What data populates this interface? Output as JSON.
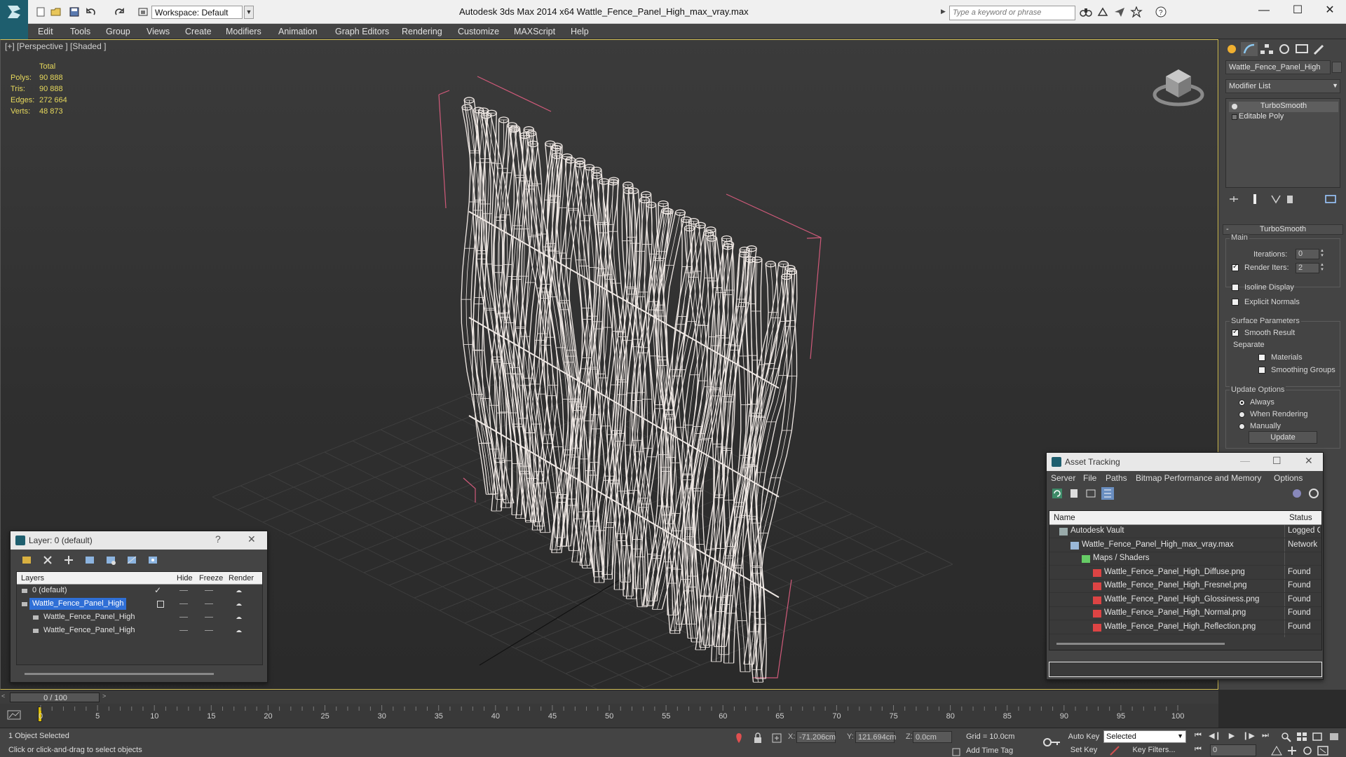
{
  "titlebar": {
    "workspace": "Workspace: Default",
    "app_title": "Autodesk 3ds Max  2014 x64     Wattle_Fence_Panel_High_max_vray.max",
    "search_placeholder": "Type a keyword or phrase",
    "min": "—",
    "max": "☐",
    "close": "✕"
  },
  "menu": [
    "Edit",
    "Tools",
    "Group",
    "Views",
    "Create",
    "Modifiers",
    "Animation",
    "Graph Editors",
    "Rendering",
    "Customize",
    "MAXScript",
    "Help"
  ],
  "viewport": {
    "label": "[+] [Perspective ] [Shaded ]",
    "stats": {
      "header": "Total",
      "rows": [
        {
          "label": "Polys:",
          "value": "90 888"
        },
        {
          "label": "Tris:",
          "value": "90 888"
        },
        {
          "label": "Edges:",
          "value": "272 664"
        },
        {
          "label": "Verts:",
          "value": "48 873"
        }
      ]
    }
  },
  "command_panel": {
    "object_name": "Wattle_Fence_Panel_High",
    "modifier_list": "Modifier List",
    "stack": [
      "TurboSmooth",
      "Editable Poly"
    ],
    "rollout_title": "TurboSmooth",
    "main_label": "Main",
    "iterations_label": "Iterations:",
    "iterations_value": "0",
    "render_iters_label": "Render Iters:",
    "render_iters_value": "2",
    "render_iters_checked": true,
    "isoline_label": "Isoline Display",
    "isoline_checked": false,
    "explicit_normals_label": "Explicit Normals",
    "explicit_normals_checked": false,
    "surface_params_label": "Surface Parameters",
    "smooth_result_label": "Smooth Result",
    "smooth_result_checked": true,
    "separate_label": "Separate",
    "materials_label": "Materials",
    "materials_checked": false,
    "smoothing_groups_label": "Smoothing Groups",
    "smoothing_groups_checked": false,
    "update_options_label": "Update Options",
    "update_options": [
      "Always",
      "When Rendering",
      "Manually"
    ],
    "update_selected": 0,
    "update_button": "Update"
  },
  "layer_window": {
    "title": "Layer: 0 (default)",
    "help": "?",
    "close": "✕",
    "columns": [
      "Layers",
      "Hide",
      "Freeze",
      "Render"
    ],
    "rows": [
      {
        "name": "0 (default)",
        "selected": false,
        "indent": 1
      },
      {
        "name": "Wattle_Fence_Panel_High",
        "selected": true,
        "indent": 1
      },
      {
        "name": "Wattle_Fence_Panel_High",
        "selected": false,
        "indent": 2
      },
      {
        "name": "Wattle_Fence_Panel_High",
        "selected": false,
        "indent": 2
      }
    ]
  },
  "asset_window": {
    "title": "Asset Tracking",
    "menu": [
      "Server",
      "File",
      "Paths",
      "Bitmap Performance and Memory",
      "Options"
    ],
    "columns": [
      "Name",
      "Status"
    ],
    "rows": [
      {
        "name": "Autodesk Vault",
        "status": "Logged O",
        "indent": 1,
        "icon": "vault-icon"
      },
      {
        "name": "Wattle_Fence_Panel_High_max_vray.max",
        "status": "Network",
        "indent": 2,
        "icon": "max-file-icon"
      },
      {
        "name": "Maps / Shaders",
        "status": "",
        "indent": 3,
        "icon": "maps-icon"
      },
      {
        "name": "Wattle_Fence_Panel_High_Diffuse.png",
        "status": "Found",
        "indent": 4,
        "icon": "png-icon"
      },
      {
        "name": "Wattle_Fence_Panel_High_Fresnel.png",
        "status": "Found",
        "indent": 4,
        "icon": "png-icon"
      },
      {
        "name": "Wattle_Fence_Panel_High_Glossiness.png",
        "status": "Found",
        "indent": 4,
        "icon": "png-icon"
      },
      {
        "name": "Wattle_Fence_Panel_High_Normal.png",
        "status": "Found",
        "indent": 4,
        "icon": "png-icon"
      },
      {
        "name": "Wattle_Fence_Panel_High_Reflection.png",
        "status": "Found",
        "indent": 4,
        "icon": "png-icon"
      }
    ]
  },
  "timeline": {
    "slider_label": "0 / 100",
    "ticks": [
      "0",
      "5",
      "10",
      "15",
      "20",
      "25",
      "30",
      "35",
      "40",
      "45",
      "50",
      "55",
      "60",
      "65",
      "70",
      "75",
      "80",
      "85",
      "90",
      "95",
      "100"
    ]
  },
  "status": {
    "selection": "1 Object Selected",
    "prompt": "Click or click-and-drag to select objects",
    "x_label": "X:",
    "x_value": "-71.206cm",
    "y_label": "Y:",
    "y_value": "121.694cm",
    "z_label": "Z:",
    "z_value": "0.0cm",
    "grid": "Grid = 10.0cm",
    "add_time_tag": "Add Time Tag",
    "auto_key": "Auto Key",
    "set_key": "Set Key",
    "selected_dd": "Selected",
    "key_filters": "Key Filters...",
    "frame": "0"
  },
  "colors": {
    "accent_logo": "#1e5e6e",
    "selection_blue": "#2f6fd6",
    "stats_yellow": "#e6d85c",
    "wire_white": "#f0f0f0",
    "bbox_pink": "#d05a7a"
  }
}
